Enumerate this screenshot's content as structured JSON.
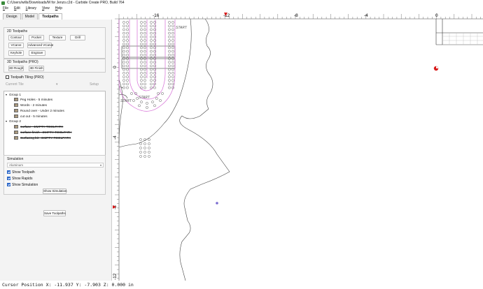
{
  "window": {
    "title": "C:/Users/wills/Downloads/M for Jenzo.c2d - Carbide Create PRO, Build 764"
  },
  "menubar": [
    "File",
    "Edit",
    "Library",
    "View",
    "Help"
  ],
  "tabs": [
    {
      "label": "Design",
      "active": false
    },
    {
      "label": "Model",
      "active": false
    },
    {
      "label": "Toolpaths",
      "active": true
    }
  ],
  "toolpaths2d": {
    "title": "2D Toolpaths",
    "buttons": [
      "Contour",
      "Pocket",
      "Texture",
      "Drill",
      "VCarve",
      "Advanced VCarve",
      "Keyhole",
      "Engrave"
    ]
  },
  "toolpaths3d": {
    "title": "3D Toolpaths (PRO)",
    "buttons": [
      "3D Rough",
      "3D Finish"
    ]
  },
  "tiling": {
    "checkbox_label": "Toolpath Tiling (PRO)",
    "current_tile": "Current Tile",
    "setup": "Setup"
  },
  "tree": {
    "groups": [
      {
        "label": "Group 1",
        "items": [
          {
            "label": "Peg Holes - 5 minutes",
            "disabled": false
          },
          {
            "label": "Words - 2 minutes",
            "disabled": false
          },
          {
            "label": "Round over - Under 2 minutes",
            "disabled": false
          },
          {
            "label": "cut out - 5 minutes",
            "disabled": false
          }
        ]
      },
      {
        "label": "Group 2",
        "items": [
          {
            "label": "surface - EMPTY TOOLPATH",
            "disabled": true
          },
          {
            "label": "surface finish - EMPTY TOOLPATH",
            "disabled": true
          },
          {
            "label": "Surfacing bit - EMPTY TOOLPATH",
            "disabled": true
          }
        ]
      }
    ]
  },
  "simulation": {
    "title": "Simulation",
    "material": "Aluminum",
    "show_toolpath": {
      "label": "Show Toolpath",
      "checked": true
    },
    "show_rapids": {
      "label": "Show Rapids",
      "checked": true
    },
    "show_simulation": {
      "label": "Show Simulation",
      "checked": true
    },
    "button": "Show Simulation"
  },
  "save_button": "Save Toolpaths",
  "canvas": {
    "ruler_top_labels": [
      "-16",
      "-12",
      "-8",
      "-4",
      "0"
    ],
    "ruler_left_labels": [
      "0",
      "-4",
      "-8",
      "-12"
    ],
    "text_labels": [
      "START",
      "START",
      "START"
    ]
  },
  "status": "Cursor Position X: -11.937 Y: -7.903 Z: 0.000 in",
  "colors": {
    "accent": "#d81b1b",
    "path": "#d56bd5",
    "select": "#2a66c8"
  }
}
